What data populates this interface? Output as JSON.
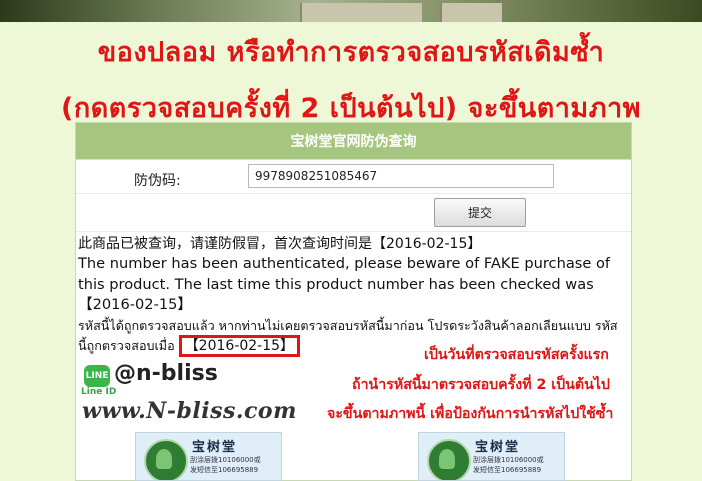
{
  "headline": {
    "line1": "ของปลอม หรือทำการตรวจสอบรหัสเดิมซ้ำ",
    "line2": "(กดตรวจสอบครั้งที่ 2 เป็นต้นไป) จะขึ้นตามภาพ"
  },
  "panel": {
    "title": "宝树堂官网防伪查询",
    "field_label": "防伪码:",
    "code_value": "9978908251085467",
    "submit_label": "提交",
    "result_zh": "此商品已被查询，请谨防假冒，首次查询时间是【2016-02-15】",
    "result_en": "The number has been authenticated, please beware of FAKE purchase of this product. The last time this product number has been checked was【2016-02-15】",
    "result_th_prefix": "รหัสนี้ได้ถูกตรวจสอบแล้ว หากท่านไม่เคยตรวจสอบรหัสนี้มาก่อน โปรดระวังสินค้าลอกเลียนแบบ รหัสนี้ถูกตรวจสอบเมื่อ",
    "result_th_date": "【2016-02-15】"
  },
  "brand": {
    "line_badge": "LINE",
    "line_id": "Line ID",
    "handle": "@n-bliss",
    "website": "www.N-bliss.com"
  },
  "notes": {
    "line1": "เป็นวันที่ตรวจสอบรหัสครั้งแรก",
    "line2": "ถ้านำรหัสนี้มาตรวจสอบครั้งที่ 2 เป็นต้นไป",
    "line3": "จะขึ้นตามภาพนี้ เพื่อป้องกันการนำรหัสไปใช้ซ้ำ"
  },
  "seal": {
    "brand": "宝树堂",
    "line1": "刮涂层拨10106000或",
    "line2": "发短信至106695889"
  },
  "colors": {
    "accent_red": "#e01616",
    "header_green": "#a6c680",
    "background": "#eef8d6"
  }
}
